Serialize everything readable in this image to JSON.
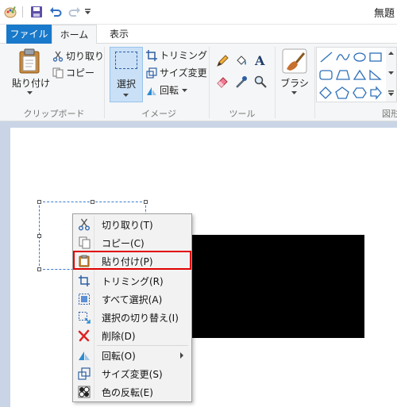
{
  "window": {
    "title": "無題"
  },
  "quick_access": {
    "icons": [
      "paint-app-icon",
      "save-icon",
      "undo-icon",
      "redo-icon",
      "customize-dropdown-icon"
    ]
  },
  "tabs": [
    {
      "label": "ファイル",
      "active": false
    },
    {
      "label": "ホーム",
      "active": true
    },
    {
      "label": "表示",
      "active": false
    }
  ],
  "ribbon": {
    "clipboard": {
      "paste_label": "貼り付け",
      "cut_label": "切り取り",
      "copy_label": "コピー",
      "group_label": "クリップボード"
    },
    "image": {
      "select_label": "選択",
      "crop_label": "トリミング",
      "resize_label": "サイズ変更",
      "rotate_label": "回転",
      "group_label": "イメージ"
    },
    "tools": {
      "group_label": "ツール"
    },
    "brushes": {
      "label": "ブラシ"
    },
    "shapes": {
      "group_label": "図形"
    }
  },
  "colors": {
    "accent": "#1979ca",
    "selection_bg": "#c9e0f7",
    "highlight_border": "#e00000",
    "canvas_bg": "#c9d5e6"
  },
  "context_menu": {
    "items": [
      {
        "label": "切り取り(T)",
        "icon": "scissors-icon"
      },
      {
        "label": "コピー(C)",
        "icon": "copy-icon"
      },
      {
        "label": "貼り付け(P)",
        "icon": "paste-icon",
        "highlighted": true
      },
      {
        "label": "トリミング(R)",
        "icon": "crop-icon"
      },
      {
        "label": "すべて選択(A)",
        "icon": "select-all-icon"
      },
      {
        "label": "選択の切り替え(I)",
        "icon": "invert-selection-icon"
      },
      {
        "label": "削除(D)",
        "icon": "delete-icon"
      },
      {
        "label": "回転(O)",
        "icon": "rotate-icon",
        "submenu": true
      },
      {
        "label": "サイズ変更(S)",
        "icon": "resize-icon"
      },
      {
        "label": "色の反転(E)",
        "icon": "invert-color-icon"
      }
    ]
  }
}
